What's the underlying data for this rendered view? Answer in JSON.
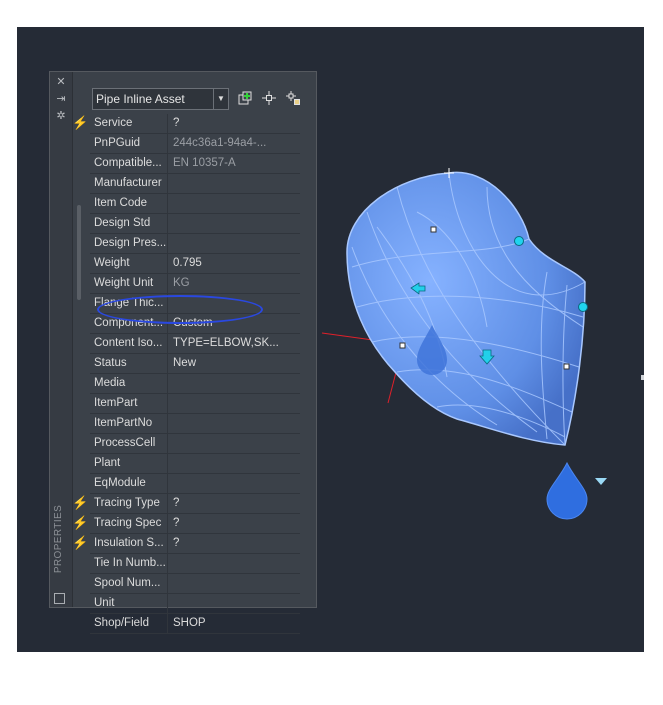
{
  "palette": {
    "title": "PROPERTIES",
    "selector_value": "Pipe Inline Asset",
    "strip_buttons": [
      "close-icon",
      "auto-hide-icon",
      "settings-icon"
    ],
    "toolbar_icons": [
      "add-component-icon",
      "pick-point-icon",
      "quick-select-icon"
    ],
    "rows": [
      {
        "name": "Service",
        "value": "?",
        "bolt": true
      },
      {
        "name": "PnPGuid",
        "value": "244c36a1-94a4-...",
        "readonly": true
      },
      {
        "name": "Compatible...",
        "value": "EN 10357-A",
        "readonly": true
      },
      {
        "name": "Manufacturer",
        "value": ""
      },
      {
        "name": "Item Code",
        "value": ""
      },
      {
        "name": "Design Std",
        "value": ""
      },
      {
        "name": "Design Pres...",
        "value": ""
      },
      {
        "name": "Weight",
        "value": "0.795"
      },
      {
        "name": "Weight Unit",
        "value": "KG",
        "readonly": true
      },
      {
        "name": "Flange Thic...",
        "value": ""
      },
      {
        "name": "Component...",
        "value": "Custom"
      },
      {
        "name": "Content Iso...",
        "value": "TYPE=ELBOW,SK..."
      },
      {
        "name": "Status",
        "value": "New"
      },
      {
        "name": "Media",
        "value": ""
      },
      {
        "name": "ItemPart",
        "value": ""
      },
      {
        "name": "ItemPartNo",
        "value": ""
      },
      {
        "name": "ProcessCell",
        "value": ""
      },
      {
        "name": "Plant",
        "value": ""
      },
      {
        "name": "EqModule",
        "value": ""
      },
      {
        "name": "Tracing Type",
        "value": "?",
        "bolt": true
      },
      {
        "name": "Tracing Spec",
        "value": "?",
        "bolt": true
      },
      {
        "name": "Insulation S...",
        "value": "?",
        "bolt": true
      },
      {
        "name": "Tie In Numb...",
        "value": ""
      },
      {
        "name": "Spool Num...",
        "value": ""
      },
      {
        "name": "Unit",
        "value": ""
      },
      {
        "name": "Shop/Field",
        "value": "SHOP"
      }
    ]
  },
  "colors": {
    "viewport_bg": "#252b36",
    "palette_bg": "#3b4149",
    "bolt": "#f2c030",
    "annotation": "#2a48e0",
    "elbow_fill": "#6e9ef0",
    "elbow_edge": "#a9c8ff",
    "grip": "#20d4ee",
    "axis": "#e0202a"
  }
}
